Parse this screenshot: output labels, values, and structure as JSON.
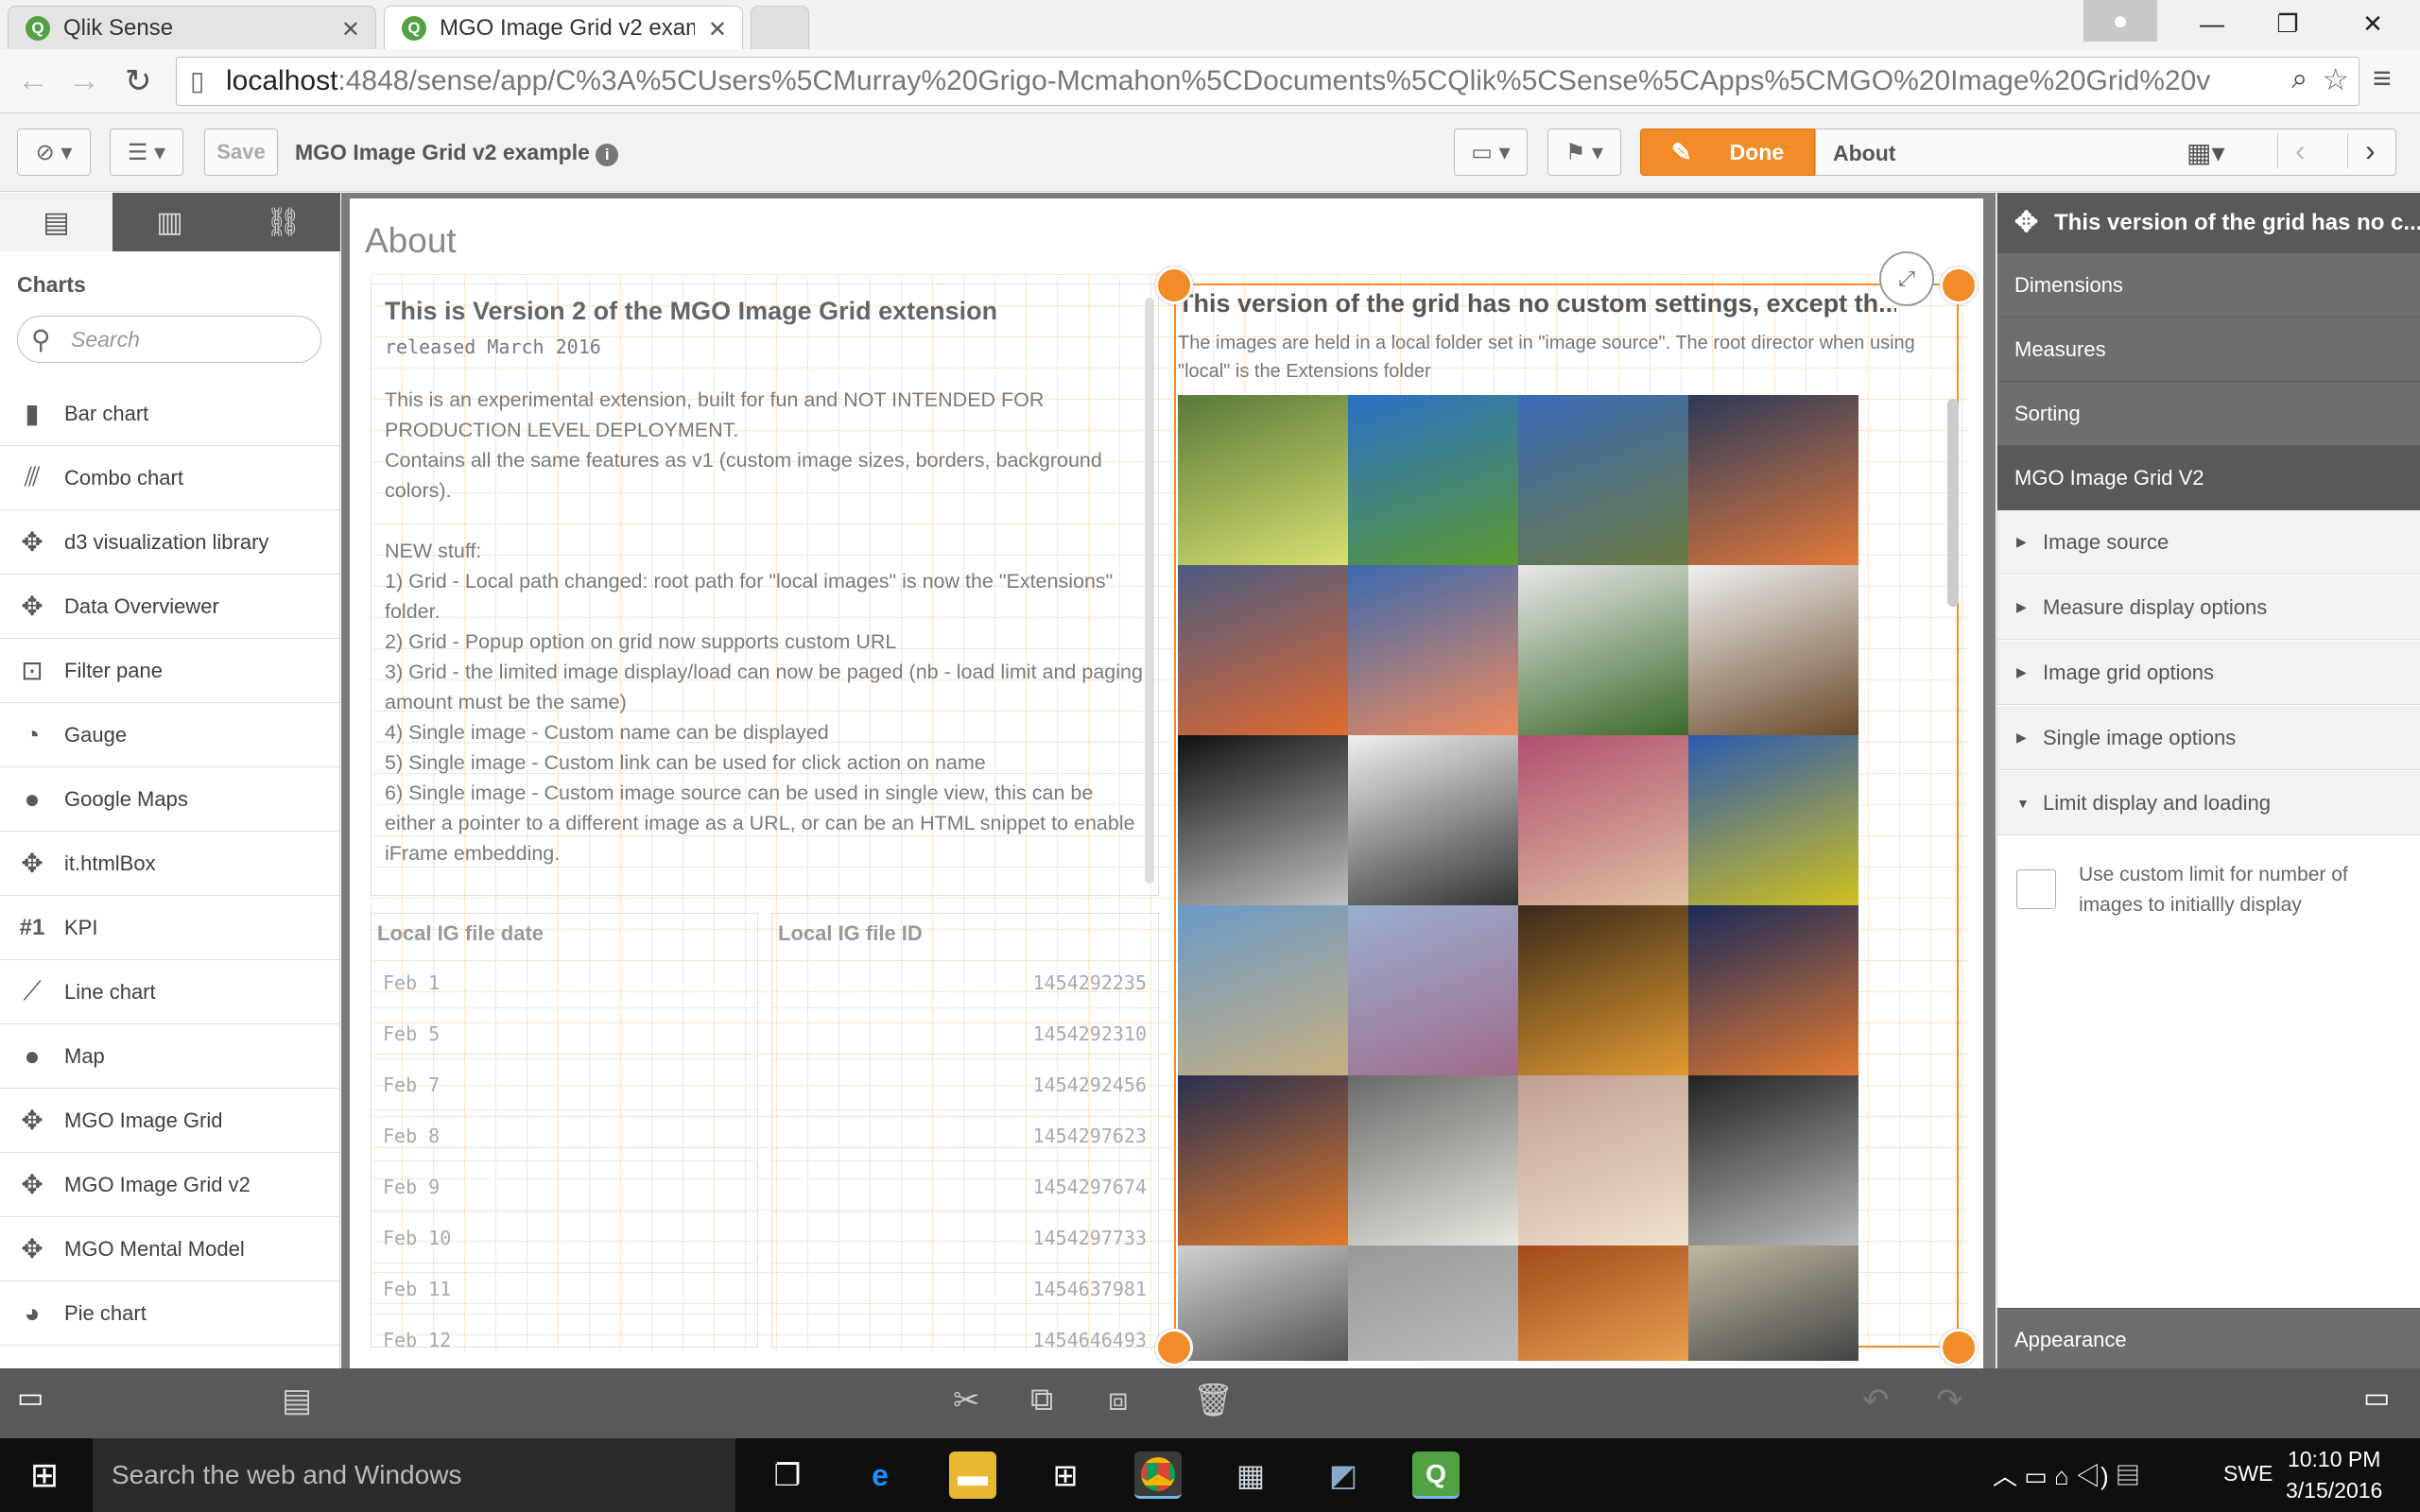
{
  "browser": {
    "tabs": [
      {
        "title": "Qlik Sense"
      },
      {
        "title": "MGO Image Grid v2 exam"
      }
    ],
    "url_host": "localhost",
    "url_path": ":4848/sense/app/C%3A%5CUsers%5CMurray%20Grigo-Mcmahon%5CDocuments%5CQlik%5CSense%5CApps%5CMGO%20Image%20Grid%20v"
  },
  "toolbar": {
    "save_label": "Save",
    "app_title": "MGO Image Grid v2 example",
    "done_label": "Done",
    "sheet_name": "About"
  },
  "left_panel": {
    "heading": "Charts",
    "search_placeholder": "Search",
    "items": [
      {
        "label": "Bar chart",
        "icon": "bar-chart-icon"
      },
      {
        "label": "Combo chart",
        "icon": "combo-chart-icon"
      },
      {
        "label": "d3 visualization library",
        "icon": "puzzle-icon"
      },
      {
        "label": "Data Overviewer",
        "icon": "puzzle-icon"
      },
      {
        "label": "Filter pane",
        "icon": "filter-pane-icon"
      },
      {
        "label": "Gauge",
        "icon": "gauge-icon"
      },
      {
        "label": "Google Maps",
        "icon": "globe-icon"
      },
      {
        "label": "it.htmlBox",
        "icon": "puzzle-icon"
      },
      {
        "label": "KPI",
        "icon": "kpi-icon"
      },
      {
        "label": "Line chart",
        "icon": "line-chart-icon"
      },
      {
        "label": "Map",
        "icon": "globe-icon"
      },
      {
        "label": "MGO Image Grid",
        "icon": "puzzle-icon"
      },
      {
        "label": "MGO Image Grid v2",
        "icon": "puzzle-icon"
      },
      {
        "label": "MGO Mental Model",
        "icon": "puzzle-icon"
      },
      {
        "label": "Pie chart",
        "icon": "pie-chart-icon"
      }
    ]
  },
  "sheet": {
    "title": "About",
    "text_object": {
      "heading": "This is Version 2 of the MGO Image Grid extension",
      "released": "released March 2016",
      "lines": [
        "This is an experimental extension, built for fun and NOT INTENDED FOR PRODUCTION LEVEL DEPLOYMENT.",
        "Contains all the same features as v1 (custom image sizes, borders, background colors).",
        "",
        "NEW stuff:",
        "1) Grid - Local path changed: root path for \"local images\" is now the \"Extensions\" folder.",
        "2) Grid - Popup option on grid now supports custom URL",
        "3) Grid - the limited image display/load can now be paged (nb - load limit and paging amount must be the same)",
        "4) Single image - Custom name can be displayed",
        "5) Single image - Custom link can be used for click action on name",
        "6) Single image - Custom image source can be used in single view, this can be either a pointer to a different image as a URL, or can be an HTML snippet to enable iFrame embedding."
      ]
    },
    "date_table": {
      "header": "Local IG file date",
      "rows": [
        "Feb 1",
        "Feb 5",
        "Feb 7",
        "Feb 8",
        "Feb 9",
        "Feb 10",
        "Feb 11",
        "Feb 12"
      ]
    },
    "id_table": {
      "header": "Local IG file ID",
      "rows": [
        "1454292235",
        "1454292310",
        "1454292456",
        "1454297623",
        "1454297674",
        "1454297733",
        "1454637981",
        "1454646493"
      ]
    },
    "image_grid": {
      "title": "This version of the grid has no custom settings, except th...",
      "description": "The images are held in a local folder set in \"image source\". The root director when using \"local\" is the Extensions folder",
      "photos": [
        {
          "colors": [
            "#5a7a3a",
            "#d8e070"
          ]
        },
        {
          "colors": [
            "#2a70c8",
            "#5a9a30"
          ]
        },
        {
          "colors": [
            "#3a6ab8",
            "#6a7a40"
          ]
        },
        {
          "colors": [
            "#2c3a5a",
            "#e27a3a"
          ]
        },
        {
          "colors": [
            "#4a5a80",
            "#e06a30"
          ]
        },
        {
          "colors": [
            "#3a6ab0",
            "#f08a5a"
          ]
        },
        {
          "colors": [
            "#e8e8e8",
            "#3a6a2a"
          ]
        },
        {
          "colors": [
            "#f0f0f0",
            "#6a4a2a"
          ]
        },
        {
          "colors": [
            "#111111",
            "#c0c0c0"
          ]
        },
        {
          "colors": [
            "#f0f0f0",
            "#333333"
          ]
        },
        {
          "colors": [
            "#b05070",
            "#e0c0a0"
          ]
        },
        {
          "colors": [
            "#2a5ab0",
            "#d0c020"
          ]
        },
        {
          "colors": [
            "#6a9ac8",
            "#c8b080"
          ]
        },
        {
          "colors": [
            "#9ab0d0",
            "#a06a8a"
          ]
        },
        {
          "colors": [
            "#3a2a1a",
            "#e09a30"
          ]
        },
        {
          "colors": [
            "#1a2a5a",
            "#e07a30"
          ]
        },
        {
          "colors": [
            "#2a3050",
            "#e07a2a"
          ]
        },
        {
          "colors": [
            "#6a6a6a",
            "#e8e8e0"
          ]
        },
        {
          "colors": [
            "#c0a090",
            "#f0e0d0"
          ]
        },
        {
          "colors": [
            "#222222",
            "#bbbbbb"
          ]
        },
        {
          "colors": [
            "#d0d0d0",
            "#555555"
          ]
        },
        {
          "colors": [
            "#999999",
            "#bbbbbb"
          ]
        },
        {
          "colors": [
            "#a04a1a",
            "#e8a050"
          ]
        },
        {
          "colors": [
            "#c0b8a0",
            "#444444"
          ]
        }
      ]
    }
  },
  "right_panel": {
    "header": "This version of the grid has no c...",
    "sections": [
      "Dimensions",
      "Measures",
      "Sorting",
      "MGO Image Grid V2"
    ],
    "subsections": [
      "Image source",
      "Measure display options",
      "Image grid options",
      "Single image options",
      "Limit display and loading"
    ],
    "checkbox_label": "Use custom limit for number of images to initiallly display",
    "appearance": "Appearance"
  },
  "taskbar": {
    "search_placeholder": "Search the web and Windows",
    "language": "SWE",
    "time": "10:10 PM",
    "date": "3/15/2016"
  },
  "colors": {
    "accent": "#f28c28",
    "panel_dark": "#595959",
    "taskbar": "#0f0f0f"
  }
}
